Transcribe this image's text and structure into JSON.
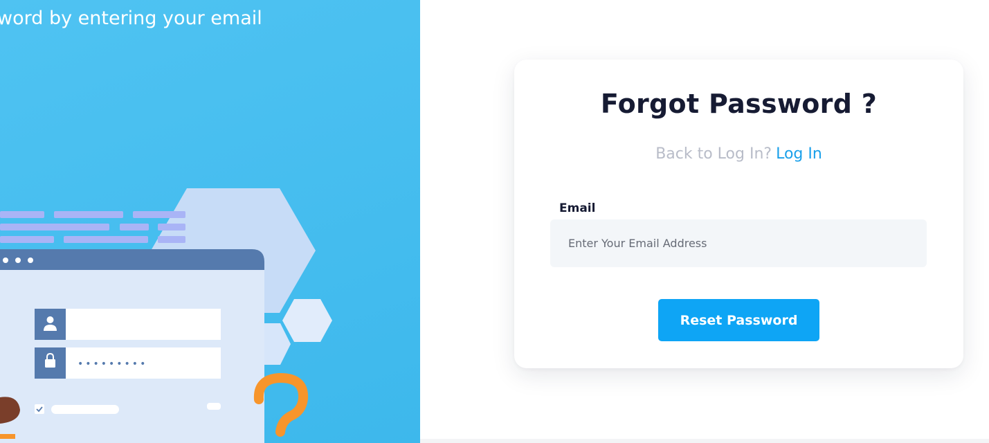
{
  "hero": {
    "line_1": "word by entering your email"
  },
  "card": {
    "title": "Forgot Password ?",
    "back_prompt": "Back to Log In?",
    "login_link": "Log In",
    "email_label": "Email",
    "email_placeholder": "Enter Your Email Address",
    "email_value": "",
    "reset_button": "Reset Password"
  },
  "illustration": {
    "password_mask": "•••••••••"
  },
  "colors": {
    "left_panel": "#44bdef",
    "accent": "#0ea5f5",
    "link": "#1aa0ea",
    "title": "#161b33",
    "muted": "#b8bcc8",
    "input_bg": "#f3f6f9"
  },
  "icons": [
    "user-icon",
    "lock-icon",
    "checkbox-icon",
    "question-mark-icon"
  ]
}
